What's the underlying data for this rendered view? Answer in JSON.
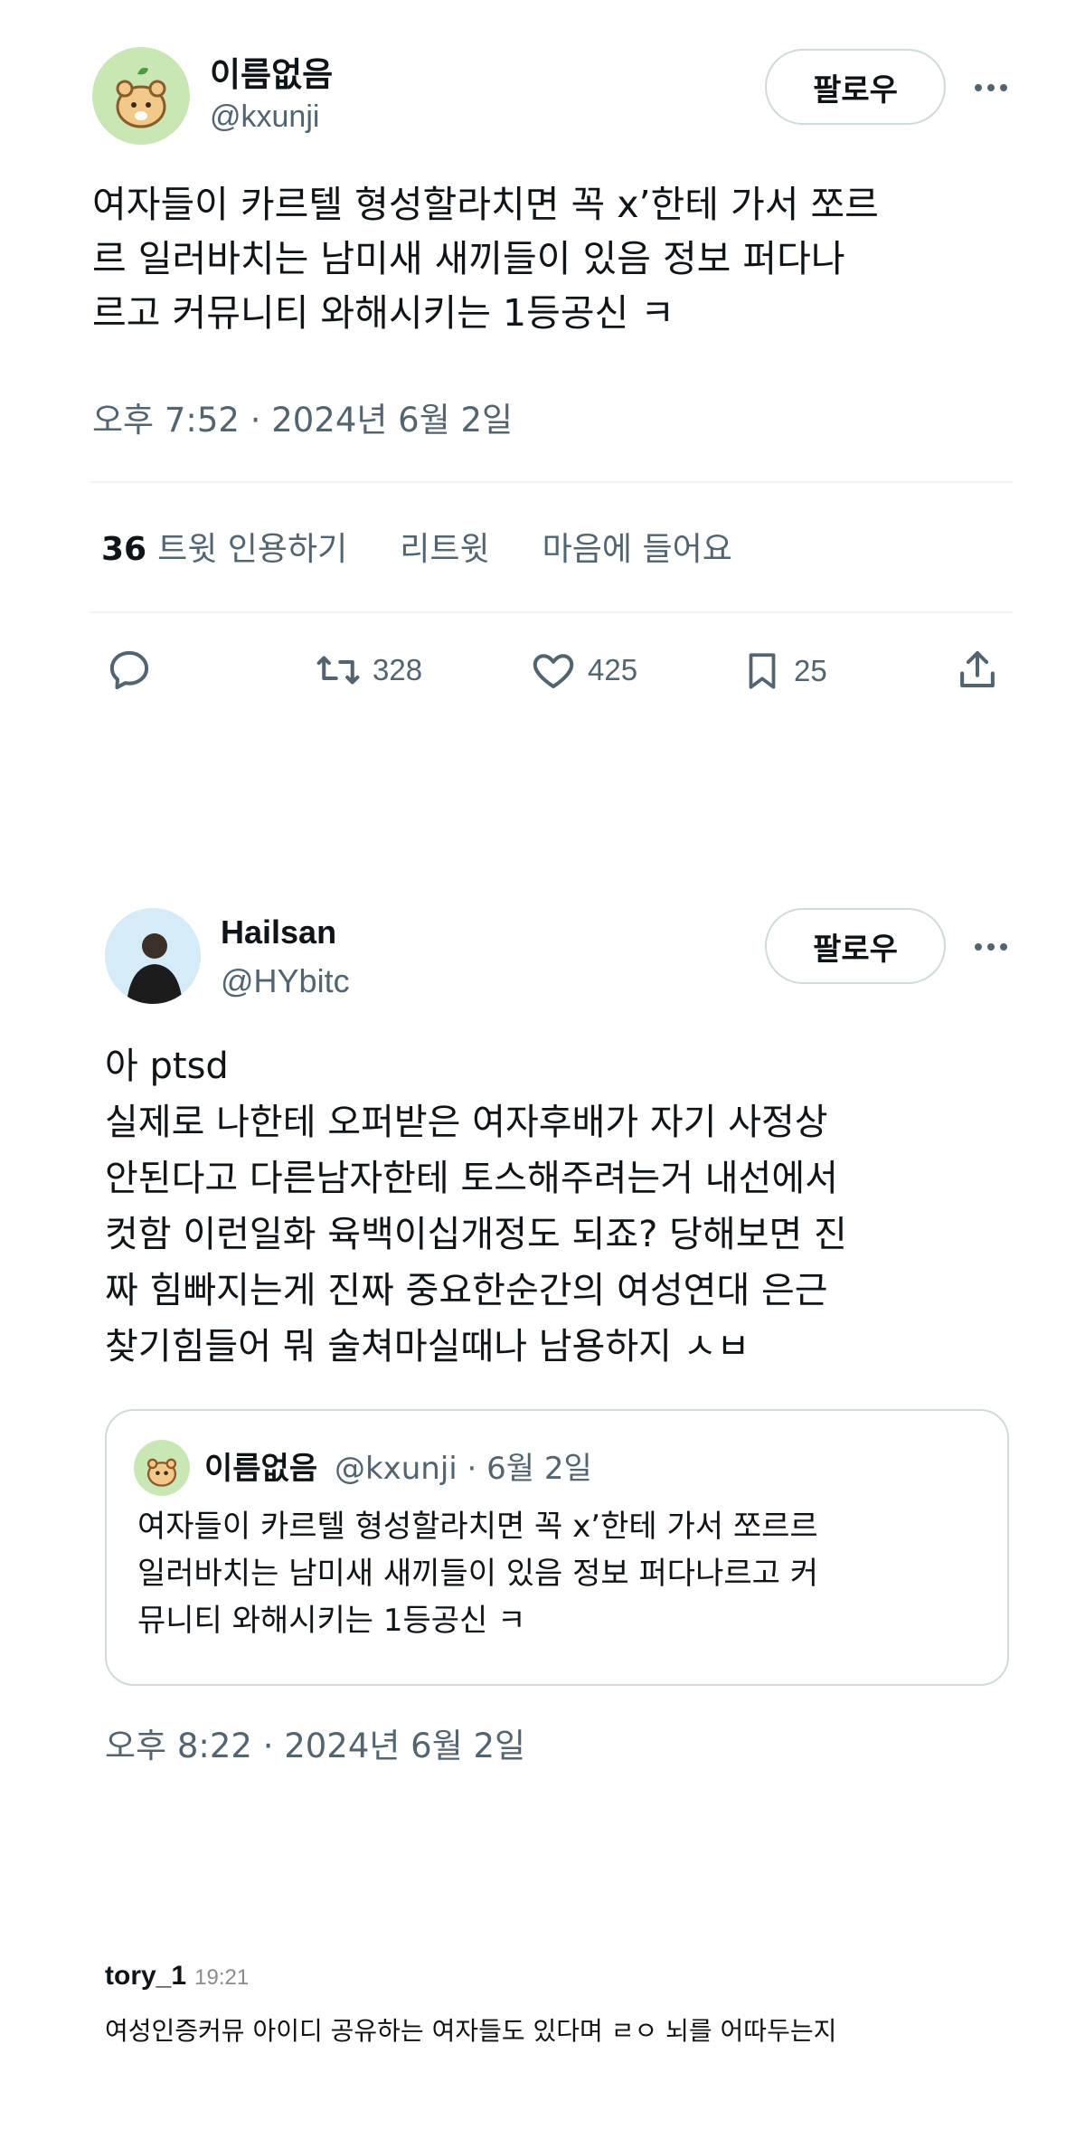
{
  "tweet1": {
    "display_name": "이름없음",
    "handle": "@kxunji",
    "follow_label": "팔로우",
    "text": "여자들이 카르텔 형성할라치면 꼭 x’한테 가서 쪼르\n르 일러바치는 남미새 새끼들이 있음 정보 퍼다나\n르고 커뮤니티 와해시키는 1등공신 ㅋ",
    "timestamp": "오후 7:52 · 2024년 6월 2일",
    "quote_count": "36",
    "quote_label": "트윗 인용하기",
    "retweet_label": "리트윗",
    "like_label": "마음에 들어요",
    "retweets": "328",
    "likes": "425",
    "bookmarks": "25"
  },
  "tweet2": {
    "display_name": "Hailsan",
    "handle": "@HYbitc",
    "follow_label": "팔로우",
    "text": "아 ptsd\n실제로 나한테 오퍼받은 여자후배가 자기 사정상\n안된다고 다른남자한테 토스해주려는거 내선에서\n컷함 이런일화 육백이십개정도 되죠? 당해보면 진\n짜 힘빠지는게 진짜 중요한순간의 여성연대 은근\n찾기힘들어 뭐 술쳐마실때나 남용하지 ㅅㅂ",
    "timestamp": "오후 8:22 · 2024년 6월 2일",
    "quote": {
      "display_name": "이름없음",
      "handle_date": "@kxunji · 6월 2일",
      "text": "여자들이 카르텔 형성할라치면 꼭 x’한테 가서 쪼르르\n일러바치는 남미새 새끼들이 있음 정보 퍼다나르고 커\n뮤니티 와해시키는 1등공신 ㅋ"
    }
  },
  "comment": {
    "author": "tory_1",
    "time": "19:21",
    "text": "여성인증커뮤 아이디 공유하는 여자들도 있다며 ㄹㅇ 뇌를 어따두는지"
  },
  "colors": {
    "text": "#0f1419",
    "secondary": "#536471",
    "border": "#cfd9de",
    "divider": "#eff3f4",
    "avatar1_bg": "#c9e7b4"
  }
}
